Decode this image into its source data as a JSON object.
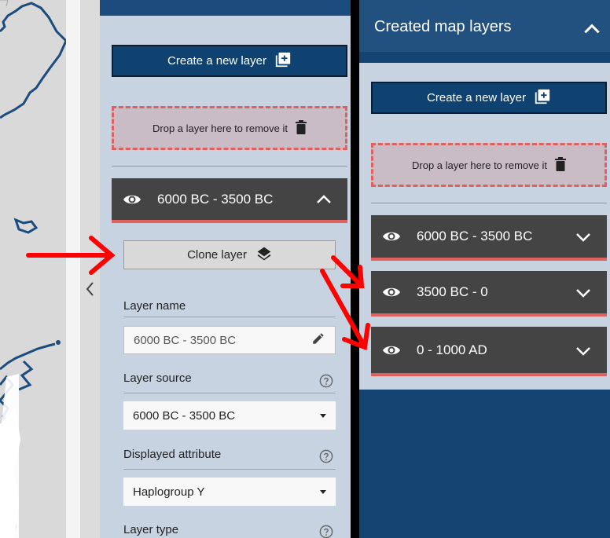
{
  "left_panel": {
    "new_layer_label": "Create a new layer",
    "drop_zone_label": "Drop a layer here to remove it",
    "layer_title": "6000 BC - 3500 BC",
    "clone_label": "Clone layer",
    "layer_name_label": "Layer name",
    "layer_name_value": "6000 BC - 3500 BC",
    "layer_source_label": "Layer source",
    "layer_source_value": "6000 BC - 3500 BC",
    "displayed_attribute_label": "Displayed attribute",
    "displayed_attribute_value": "Haplogroup Y",
    "layer_type_label": "Layer type"
  },
  "right_panel": {
    "title": "Created map layers",
    "new_layer_label": "Create a new layer",
    "drop_zone_label": "Drop a layer here to remove it",
    "layers": [
      {
        "title": "6000 BC - 3500 BC"
      },
      {
        "title": "3500 BC - 0"
      },
      {
        "title": "0 - 1000 AD"
      }
    ]
  },
  "colors": {
    "header_blue": "#134472",
    "button_blue": "#0f4270",
    "panel_bg": "#c7d3e0",
    "layer_header": "#444444",
    "accent_red": "#e06060",
    "arrow_red": "#ff0000"
  },
  "icons": [
    "eye-icon",
    "chevron-up-icon",
    "chevron-down-icon",
    "chevron-left-icon",
    "add-box-icon",
    "trash-icon",
    "layers-icon",
    "pencil-icon",
    "help-icon"
  ]
}
